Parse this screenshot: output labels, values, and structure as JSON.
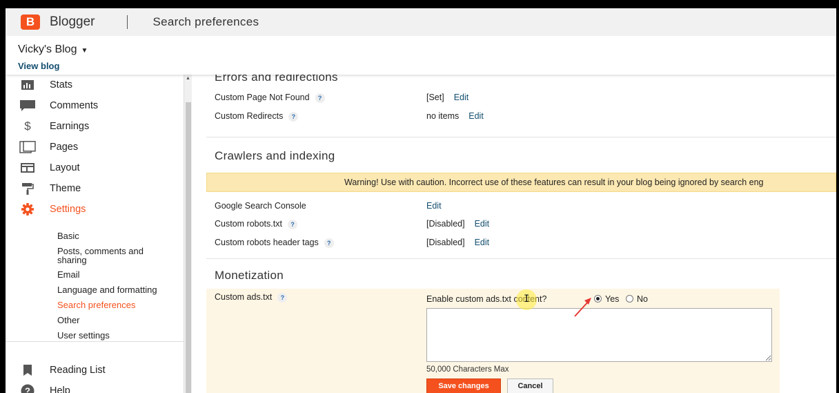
{
  "header": {
    "brand": "Blogger",
    "brand_icon": "B",
    "page_title": "Search preferences"
  },
  "blog": {
    "name": "Vicky's Blog",
    "view_blog": "View blog"
  },
  "sidebar": {
    "items": [
      {
        "label": "Stats",
        "icon": "bar-chart-icon"
      },
      {
        "label": "Comments",
        "icon": "comment-icon"
      },
      {
        "label": "Earnings",
        "icon": "dollar-icon"
      },
      {
        "label": "Pages",
        "icon": "pages-icon"
      },
      {
        "label": "Layout",
        "icon": "layout-icon"
      },
      {
        "label": "Theme",
        "icon": "paint-roller-icon"
      },
      {
        "label": "Settings",
        "icon": "gear-icon"
      }
    ],
    "settings_sub": [
      {
        "label": "Basic"
      },
      {
        "label": "Posts, comments and"
      },
      {
        "label": "sharing"
      },
      {
        "label": "Email"
      },
      {
        "label": "Language and formatting"
      },
      {
        "label": "Search preferences"
      },
      {
        "label": "Other"
      },
      {
        "label": "User settings"
      }
    ],
    "bottom": [
      {
        "label": "Reading List",
        "icon": "bookmark-icon"
      },
      {
        "label": "Help",
        "icon": "help-icon"
      }
    ]
  },
  "errors": {
    "title": "Errors and redirections",
    "rows": [
      {
        "label": "Custom Page Not Found",
        "value": "[Set]",
        "edit": "Edit"
      },
      {
        "label": "Custom Redirects",
        "value": "no items",
        "edit": "Edit"
      }
    ]
  },
  "crawlers": {
    "title": "Crawlers and indexing",
    "warning": "Warning! Use with caution. Incorrect use of these features can result in your blog being ignored by search eng",
    "rows": [
      {
        "label": "Google Search Console",
        "value": "",
        "edit": "Edit"
      },
      {
        "label": "Custom robots.txt",
        "value": "[Disabled]",
        "edit": "Edit"
      },
      {
        "label": "Custom robots header tags",
        "value": "[Disabled]",
        "edit": "Edit"
      }
    ]
  },
  "monetization": {
    "title": "Monetization",
    "label": "Custom ads.txt",
    "question": "Enable custom ads.txt content?",
    "yes": "Yes",
    "no": "No",
    "selected": "Yes",
    "textarea_value": "",
    "max_note": "50,000 Characters Max",
    "save": "Save changes",
    "cancel": "Cancel"
  },
  "help_glyph": "?",
  "colors": {
    "accent": "#f4511e",
    "link": "#134e6f",
    "warning_bg": "#fce8b2",
    "monetization_bg": "#fef6e4"
  }
}
